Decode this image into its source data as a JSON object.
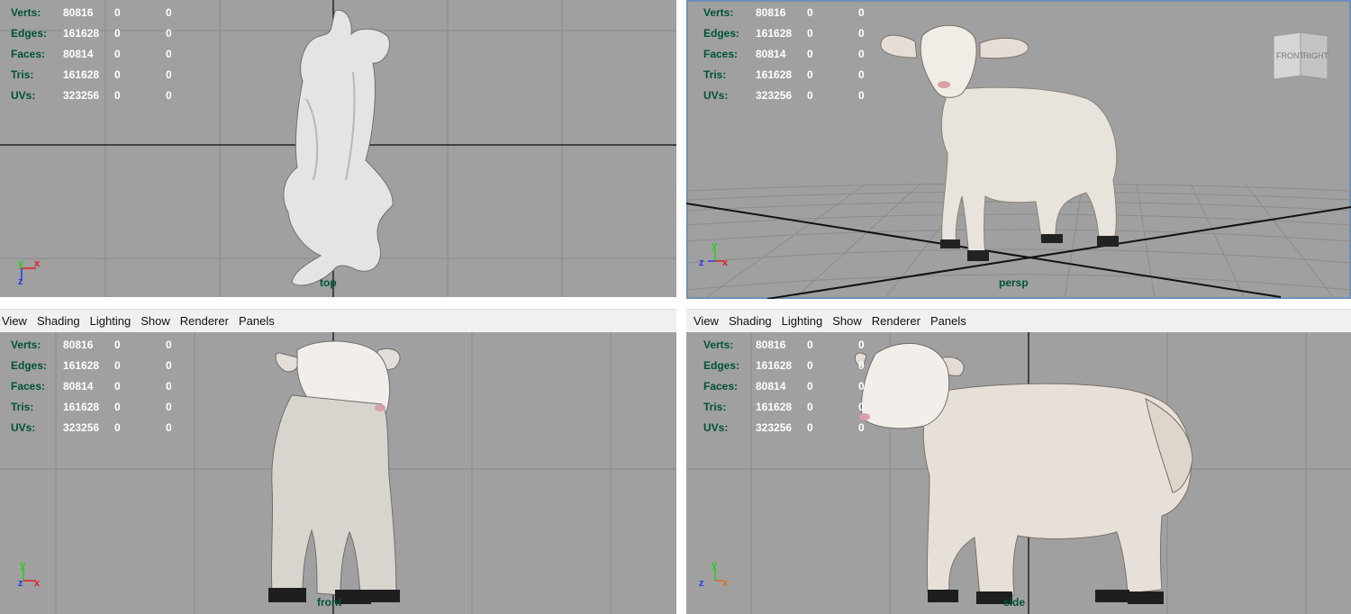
{
  "hud_rows": [
    {
      "label": "Verts:",
      "v1": "80816",
      "v2": "0",
      "v3": "0"
    },
    {
      "label": "Edges:",
      "v1": "161628",
      "v2": "0",
      "v3": "0"
    },
    {
      "label": "Faces:",
      "v1": "80814",
      "v2": "0",
      "v3": "0"
    },
    {
      "label": "Tris:",
      "v1": "161628",
      "v2": "0",
      "v3": "0"
    },
    {
      "label": "UVs:",
      "v1": "323256",
      "v2": "0",
      "v3": "0"
    }
  ],
  "menu": {
    "view": "View",
    "shading": "Shading",
    "lighting": "Lighting",
    "show": "Show",
    "renderer": "Renderer",
    "panels": "Panels"
  },
  "cameras": {
    "top": "top",
    "persp": "persp",
    "front": "front",
    "side": "side"
  },
  "viewcube": {
    "front": "FRONT",
    "right": "RIGHT"
  },
  "axis_letters": {
    "x": "x",
    "y": "y",
    "z": "z"
  },
  "colors": {
    "viewport_bg": "#a0a0a0",
    "hud_label": "#00523a",
    "axis_x": "#e02020",
    "axis_y": "#20d020",
    "axis_z": "#2040e0",
    "active_border": "#6e8fb8"
  }
}
